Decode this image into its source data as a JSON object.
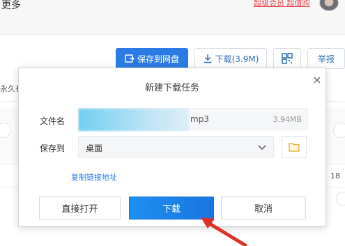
{
  "background": {
    "more_label": "更多",
    "vip_link": "超级会员 超值购",
    "actions": {
      "save_to_cloud": "保存到网盘",
      "download": "下载(3.9M)",
      "report": "举报"
    },
    "side_text": "永久有",
    "count": "18"
  },
  "dialog": {
    "title": "新建下载任务",
    "close": "×",
    "filename_label": "文件名",
    "filename_ext": "mp3",
    "file_size": "3.94MB",
    "save_to_label": "保存到",
    "save_path": "桌面",
    "copy_link": "复制链接地址",
    "buttons": {
      "open": "直接打开",
      "download": "下载",
      "cancel": "取消"
    }
  },
  "colors": {
    "accent": "#2c7be5",
    "primary_button": "#1976e0",
    "annotation_arrow": "#e0302a"
  },
  "icons": [
    "save-cloud-icon",
    "download-icon",
    "qr-code-icon",
    "close-icon",
    "chevron-down-icon",
    "folder-icon",
    "red-arrow-annotation"
  ]
}
